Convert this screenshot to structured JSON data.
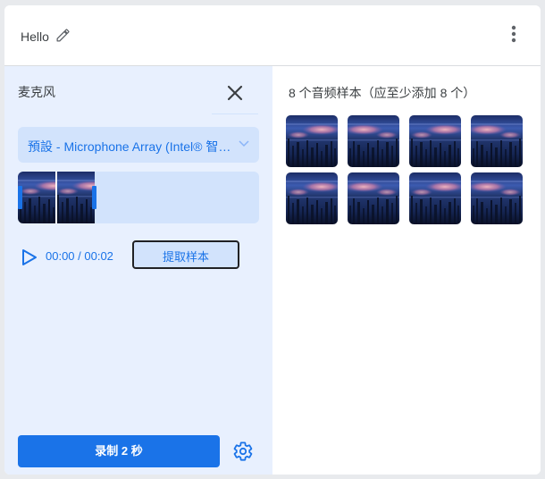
{
  "header": {
    "title": "Hello"
  },
  "mic_panel": {
    "title": "麦克风",
    "device_select": {
      "selected": "預設 - Microphone Array (Intel® 智慧音效技術)"
    },
    "playback": {
      "time": "00:00 / 00:02"
    },
    "extract_label": "提取样本",
    "record_label": "录制 2 秒"
  },
  "samples_panel": {
    "title": "8 个音频样本（应至少添加 8 个）",
    "sample_count": 8
  },
  "colors": {
    "accent": "#1a73e8",
    "panel_bg": "#e8f0fe",
    "control_bg": "#d2e3fc",
    "spectrogram_low": "#0b1530",
    "spectrogram_high": "#e7a2b3"
  },
  "icons": [
    "pencil-icon",
    "more-vert-icon",
    "close-icon",
    "chevron-down-icon",
    "play-icon",
    "gear-icon"
  ]
}
